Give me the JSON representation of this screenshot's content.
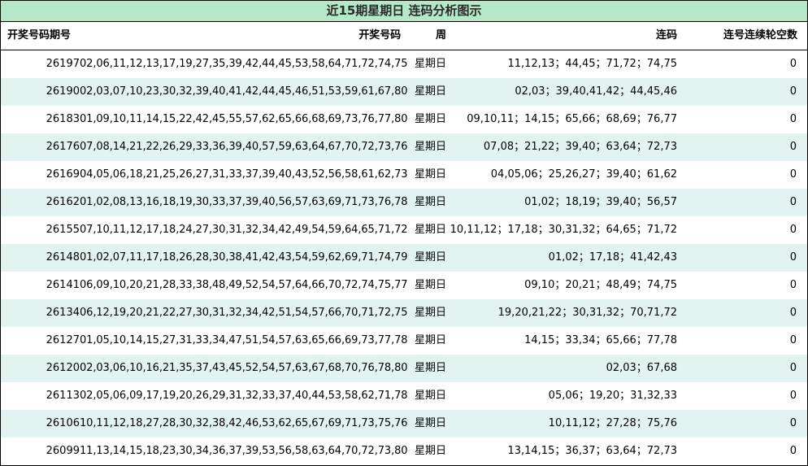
{
  "title": "近15期星期日 连码分析图示",
  "columns": {
    "issue": "开奖号码期号",
    "numbers": "开奖号码",
    "week": "周",
    "lianma": "连码",
    "gap": "连号连续轮空数"
  },
  "rows": [
    {
      "issue": "26197",
      "numbers": "02,06,11,12,13,17,19,27,35,39,42,44,45,53,58,64,71,72,74,75",
      "week": "星期日",
      "lianma": "11,12,13；44,45；71,72；74,75",
      "gap": "0"
    },
    {
      "issue": "26190",
      "numbers": "02,03,07,10,23,30,32,39,40,41,42,44,45,46,51,53,59,61,67,80",
      "week": "星期日",
      "lianma": "02,03；39,40,41,42；44,45,46",
      "gap": "0"
    },
    {
      "issue": "26183",
      "numbers": "01,09,10,11,14,15,22,42,45,55,57,62,65,66,68,69,73,76,77,80",
      "week": "星期日",
      "lianma": "09,10,11；14,15；65,66；68,69；76,77",
      "gap": "0"
    },
    {
      "issue": "26176",
      "numbers": "07,08,14,21,22,26,29,33,36,39,40,57,59,63,64,67,70,72,73,76",
      "week": "星期日",
      "lianma": "07,08；21,22；39,40；63,64；72,73",
      "gap": "0"
    },
    {
      "issue": "26169",
      "numbers": "04,05,06,18,21,25,26,27,31,33,37,39,40,43,52,56,58,61,62,73",
      "week": "星期日",
      "lianma": "04,05,06；25,26,27；39,40；61,62",
      "gap": "0"
    },
    {
      "issue": "26162",
      "numbers": "01,02,08,13,16,18,19,30,33,37,39,40,56,57,63,69,71,73,76,78",
      "week": "星期日",
      "lianma": "01,02；18,19；39,40；56,57",
      "gap": "0"
    },
    {
      "issue": "26155",
      "numbers": "07,10,11,12,17,18,24,27,30,31,32,34,42,49,54,59,64,65,71,72",
      "week": "星期日",
      "lianma": "10,11,12；17,18；30,31,32；64,65；71,72",
      "gap": "0"
    },
    {
      "issue": "26148",
      "numbers": "01,02,07,11,17,18,26,28,30,38,41,42,43,54,59,62,69,71,74,79",
      "week": "星期日",
      "lianma": "01,02；17,18；41,42,43",
      "gap": "0"
    },
    {
      "issue": "26141",
      "numbers": "06,09,10,20,21,28,33,38,48,49,52,54,57,64,66,70,72,74,75,77",
      "week": "星期日",
      "lianma": "09,10；20,21；48,49；74,75",
      "gap": "0"
    },
    {
      "issue": "26134",
      "numbers": "06,12,19,20,21,22,27,30,31,32,34,42,51,54,57,66,70,71,72,75",
      "week": "星期日",
      "lianma": "19,20,21,22；30,31,32；70,71,72",
      "gap": "0"
    },
    {
      "issue": "26127",
      "numbers": "01,05,10,14,15,27,31,33,34,47,51,54,57,63,65,66,69,73,77,78",
      "week": "星期日",
      "lianma": "14,15；33,34；65,66；77,78",
      "gap": "0"
    },
    {
      "issue": "26120",
      "numbers": "02,03,06,10,16,21,35,37,43,45,52,54,57,63,67,68,70,76,78,80",
      "week": "星期日",
      "lianma": "02,03；67,68",
      "gap": "0"
    },
    {
      "issue": "26113",
      "numbers": "02,05,06,09,17,19,20,26,29,31,32,33,37,40,44,53,58,62,71,78",
      "week": "星期日",
      "lianma": "05,06；19,20；31,32,33",
      "gap": "0"
    },
    {
      "issue": "26106",
      "numbers": "10,11,12,18,27,28,30,32,38,42,46,53,62,65,67,69,71,73,75,76",
      "week": "星期日",
      "lianma": "10,11,12；27,28；75,76",
      "gap": "0"
    },
    {
      "issue": "26099",
      "numbers": "11,13,14,15,18,23,30,34,36,37,39,53,56,58,63,64,70,72,73,80",
      "week": "星期日",
      "lianma": "13,14,15；36,37；63,64；72,73",
      "gap": "0"
    }
  ],
  "colors": {
    "title_bg": "#b4e8c7",
    "row_shade": "#e2f4f1"
  }
}
